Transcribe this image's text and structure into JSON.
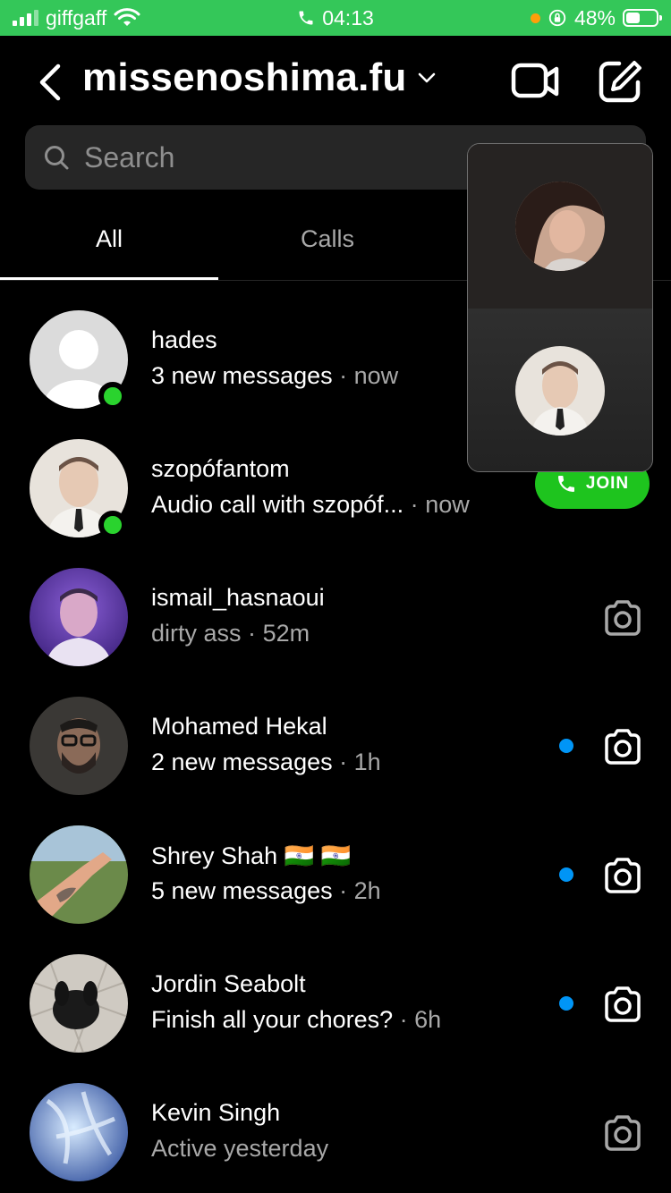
{
  "status_bar": {
    "carrier": "giffgaff",
    "time": "04:13",
    "battery": "48%",
    "battery_level": 0.48
  },
  "header": {
    "title": "missenoshima.fu",
    "icons": [
      "chevron-left-icon",
      "chevron-down-icon",
      "video-camera-icon",
      "compose-icon"
    ]
  },
  "search": {
    "placeholder": "Search"
  },
  "tabs": [
    {
      "label": "All",
      "active": true
    },
    {
      "label": "Calls",
      "active": false
    }
  ],
  "conversations": [
    {
      "name": "hades",
      "message": "3 new messages",
      "time": "now",
      "online": true,
      "unread": false,
      "trailing": "none"
    },
    {
      "name": "szopófantom",
      "message": "Audio call with szopóf...",
      "time": "now",
      "online": true,
      "unread": false,
      "trailing": "join"
    },
    {
      "name": "ismail_hasnaoui",
      "message": "dirty ass",
      "time": "52m",
      "online": false,
      "unread": false,
      "trailing": "camera"
    },
    {
      "name": "Mohamed Hekal",
      "message": "2 new messages",
      "time": "1h",
      "online": false,
      "unread": true,
      "trailing": "camera"
    },
    {
      "name": "Shrey Shah 🇮🇳 🇮🇳",
      "message": "5 new messages",
      "time": "2h",
      "online": false,
      "unread": true,
      "trailing": "camera"
    },
    {
      "name": "Jordin Seabolt",
      "message": "Finish all your chores?",
      "time": "6h",
      "online": false,
      "unread": true,
      "trailing": "camera"
    },
    {
      "name": "Kevin Singh",
      "message": "Active yesterday",
      "time": "",
      "online": false,
      "unread": false,
      "trailing": "camera"
    }
  ],
  "join_button": {
    "label": "JOIN"
  },
  "separator": "·",
  "colors": {
    "status_green": "#34c759",
    "online_green": "#2ad32e",
    "join_green": "#1ec41e",
    "unread_blue": "#0095f6",
    "background": "#000000",
    "secondary_text": "#a8a8a8"
  }
}
